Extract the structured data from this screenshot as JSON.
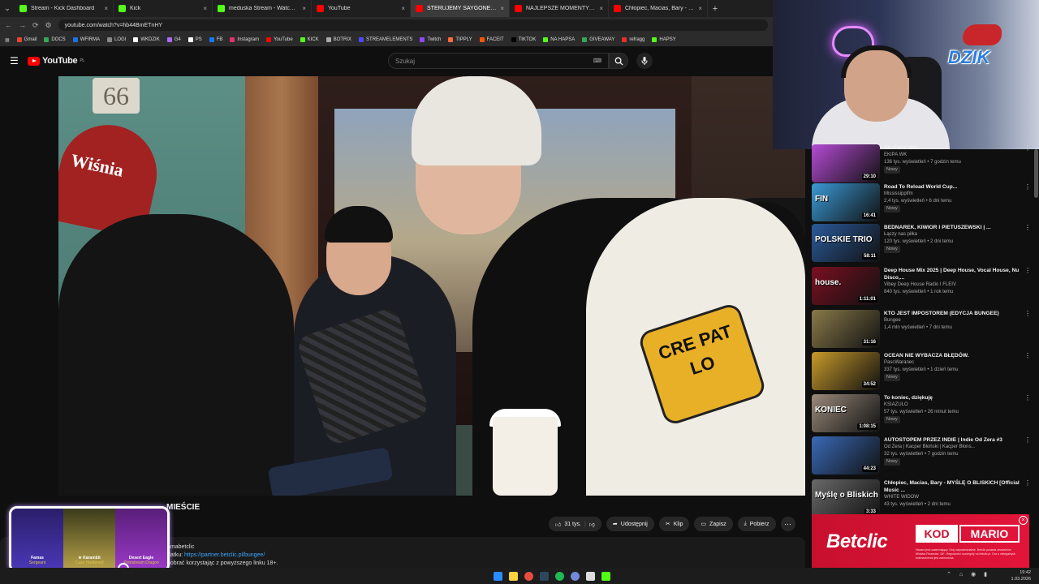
{
  "browser": {
    "tabs": [
      {
        "title": "Stream - Kick Dashboard",
        "color": "#53fc18"
      },
      {
        "title": "Kick",
        "color": "#53fc18"
      },
      {
        "title": "meduska Stream - Watch Live o",
        "color": "#53fc18"
      },
      {
        "title": "YouTube",
        "color": "#ff0000"
      },
      {
        "title": "STERUJEMY SAYGONEM N",
        "color": "#ff0000",
        "active": true
      },
      {
        "title": "NAJLEPSZE MOMENTY POLSK",
        "color": "#ff0000"
      },
      {
        "title": "Chłopiec, Macias, Bary - MYŚLĘ",
        "color": "#ff0000"
      }
    ],
    "url": "youtube.com/watch?v=hb44BmETnHY",
    "bookmarks": [
      "Gmail",
      "DOCS",
      "WFIRMA",
      "LOGI",
      "WKDZIK",
      "G4",
      "PS",
      "FB",
      "Instagram",
      "YouTube",
      "KICK",
      "BOTRIX",
      "STREAMELEMENTS",
      "Twitch",
      "TIPPLY",
      "FACEIT",
      "TIKTOK",
      "NA HAPSA",
      "GIVEAWAY",
      "refragg",
      "HAPSY"
    ]
  },
  "youtube": {
    "logo": "YouTube",
    "region": "PL",
    "search_placeholder": "Szukaj"
  },
  "video": {
    "plate_number": "66",
    "sign_text": "Wiśnia",
    "patch_text": "CRE PAT LO",
    "title_visible": "MIEŚCIE",
    "actions": {
      "likes": "31 tys.",
      "share": "Udostępnij",
      "clip": "Klip",
      "save": "Zapisz",
      "download": "Pobierz"
    },
    "description": {
      "line1": "amabetclic",
      "line2_prefix": "datku:",
      "line2_link": "https://partner.betclic.pl/bungee/",
      "line3": "pobrać korzystając z powyższego linku 18+."
    }
  },
  "overlay": {
    "knife_cards": [
      {
        "name": "Famas",
        "sub": "Sergeant"
      },
      {
        "name": "★ Karambit",
        "sub": "Case Hardened"
      },
      {
        "name": "Desert Eagle",
        "sub": "Printstream Dragon"
      }
    ],
    "streamer_brand": "DZIK",
    "sponsor": {
      "logo": "Betclic",
      "kod": "KOD",
      "code": "MARIO",
      "fine_print": "Hazard jest uzależniający. Graj odpowiedzialnie. Betclic posiada zezwolenie Ministra Finansów. 18+. Regulamin i szczegóły na betclic.pl. Gra u nielegalnych bukmacherów jest zabroniona."
    }
  },
  "recommendations": [
    {
      "title": "SIŁOWNI WK!",
      "channel": "EKIPA WK",
      "meta": "136 tys. wyświetleń • 7 godzin temu",
      "badge": "Nowy",
      "duration": "29:10",
      "color": "#b64bd6",
      "thumb_text": ""
    },
    {
      "title": "Road To Reload World Cup...",
      "channel": "Mississippifm",
      "meta": "2,4 tys. wyświetleń • 6 dni temu",
      "badge": "Nowy",
      "duration": "16:41",
      "color": "#3a9ad6",
      "thumb_text": "FIN"
    },
    {
      "title": "BEDNAREK, KIWIOR I PIETUSZEWSKI | ...",
      "channel": "Łączy nas piłka",
      "meta": "120 tys. wyświetleń • 2 dni temu",
      "badge": "Nowy",
      "duration": "58:11",
      "color": "#2a5a9a",
      "thumb_text": "POLSKIE TRIO"
    },
    {
      "title": "Deep House Mix 2025 | Deep House, Vocal House, Nu Disco,...",
      "channel": "Vibey Deep House Radio I FLEIV",
      "meta": "840 tys. wyświetleń • 1 rok temu",
      "badge": "",
      "duration": "1:11:01",
      "color": "#7a1020",
      "thumb_text": "house."
    },
    {
      "title": "KTO JEST IMPOSTOREM (EDYCJA BUNGEE)",
      "channel": "Bungee",
      "meta": "1,4 mln wyświetleń • 7 dni temu",
      "badge": "",
      "duration": "31:16",
      "color": "#8a7a4a",
      "thumb_text": ""
    },
    {
      "title": "OCEAN NIE WYBACZA BŁĘDÓW.",
      "channel": "PascWaranec",
      "meta": "337 tys. wyświetleń • 1 dzień temu",
      "badge": "Nowy",
      "duration": "34:52",
      "color": "#c79a2a",
      "thumb_text": ""
    },
    {
      "title": "To koniec, dziękuję",
      "channel": "KSIAZULO",
      "meta": "57 tys. wyświetleń • 26 minut temu",
      "badge": "Nowy",
      "duration": "1:08:15",
      "color": "#9a8a7a",
      "thumb_text": "KONIEC"
    },
    {
      "title": "AUTOSTOPEM PRZEZ INDIE | Indie Od Zera #3",
      "channel": "Od Zera | Kacper Błoński | Kacper Błons...",
      "meta": "32 tys. wyświetleń • 7 godzin temu",
      "badge": "Nowy",
      "duration": "44:23",
      "color": "#3a6ab8",
      "thumb_text": ""
    },
    {
      "title": "Chłopiec, Macias, Bary - MYŚLĘ O BLISKICH [Official Music ...",
      "channel": "WHITE WIDOW",
      "meta": "43 tys. wyświetleń • 2 dni temu",
      "badge": "",
      "duration": "3:33",
      "color": "#6a6a6a",
      "thumb_text": "Myślę o Bliskich"
    }
  ],
  "taskbar": {
    "time": "19:42",
    "date": "1.03.2026"
  }
}
